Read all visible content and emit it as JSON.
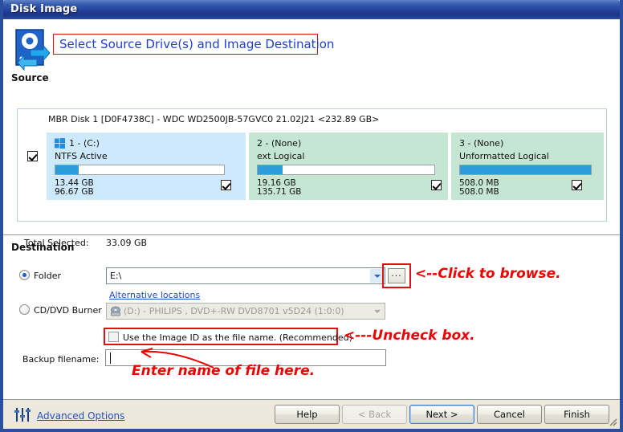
{
  "window": {
    "title": "Disk Image"
  },
  "source": {
    "icon": "hard-disk-refresh-icon",
    "label": "Source",
    "headline": "Select Source Drive(s) and Image Destination",
    "disk_title": "MBR Disk 1 [D0F4738C] - WDC WD2500JB-57GVC0 21.02J21  <232.89 GB>",
    "disk_selected": true,
    "partitions": [
      {
        "name": "1 -  (C:)",
        "filesystem": "NTFS Active",
        "used": "13.44 GB",
        "total": "96.67 GB",
        "fill_percent": 14,
        "selected": true,
        "has_windows_logo": true
      },
      {
        "name": "2 -  (None)",
        "filesystem": "ext Logical",
        "used": "19.16 GB",
        "total": "135.71 GB",
        "fill_percent": 14,
        "selected": true,
        "has_windows_logo": false
      },
      {
        "name": "3 -  (None)",
        "filesystem": "Unformatted Logical",
        "used": "508.0 MB",
        "total": "508.0 MB",
        "fill_percent": 100,
        "selected": true,
        "has_windows_logo": false
      }
    ],
    "total_selected_label": "Total Selected:",
    "total_selected_value": "33.09 GB"
  },
  "destination": {
    "title": "Destination",
    "folder_radio_label": "Folder",
    "folder_path": "E:\\",
    "browse_button_label": "...",
    "alternative_locations_link": "Alternative locations",
    "cd_radio_label": "CD/DVD Burner",
    "cd_device": "(D:) - PHILIPS , DVD+-RW DVD8701  v5D24 (1:0:0)",
    "use_image_id_label": "Use the Image ID as the file name.  (Recommended)",
    "use_image_id_checked": false,
    "backup_filename_label": "Backup filename:",
    "backup_filename_value": ""
  },
  "annotations": [
    {
      "text": "<--Click to browse."
    },
    {
      "text": "<---Uncheck box."
    },
    {
      "text": "Enter name of file here."
    }
  ],
  "footer": {
    "advanced_icon": "sliders-icon",
    "advanced_options": "Advanced Options",
    "buttons": [
      {
        "label": "Help",
        "state": "enabled"
      },
      {
        "label": "< Back",
        "state": "disabled"
      },
      {
        "label": "Next >",
        "state": "default"
      },
      {
        "label": "Cancel",
        "state": "enabled"
      },
      {
        "label": "Finish",
        "state": "enabled"
      }
    ]
  },
  "colors": {
    "title_blue": "#23409b",
    "headline_blue": "#2040d0",
    "annotation_red": "#ee0000",
    "partition_ntfs_bg": "#cde9fb",
    "partition_ext_bg": "#c6e6d4",
    "bar_fill": "#2e9bdc",
    "link_blue": "#2050c8"
  }
}
